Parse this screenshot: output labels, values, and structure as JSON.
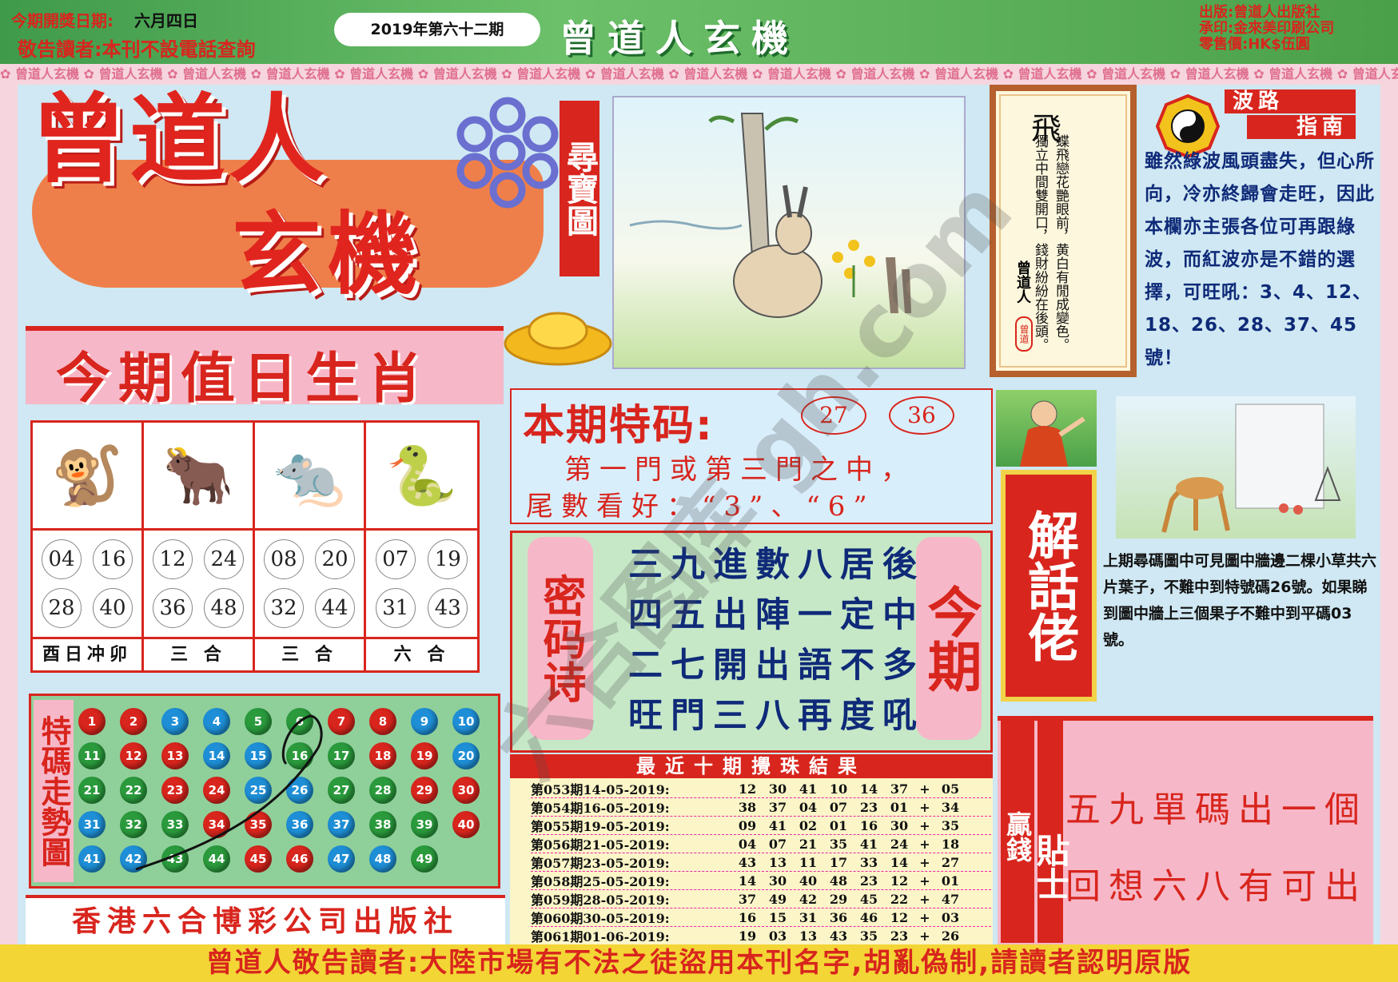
{
  "header": {
    "date_label": "今期開獎日期:",
    "date_value": "六月四日",
    "notice": "敬告讀者:本刊不設電話查詢",
    "issue": "2019年第六十二期",
    "title": "曾道人玄機",
    "publisher_lines": [
      "出版:曾道人出版社",
      "承印:金來美印刷公司",
      "零售價:HK$伍圓"
    ]
  },
  "border_text": "曾道人玄機",
  "logo": {
    "line1": "曾道人",
    "line2": "玄機"
  },
  "treasure": {
    "label": "尋寶圖"
  },
  "poem": {
    "title": "飛",
    "text": "蝶飛戀花艷眼前，黄白有閒成變色。獨立中間雙開口，錢財紛紛在後頭。",
    "signature": "曾道人",
    "seal": "曾道"
  },
  "bolu": {
    "title1": "波路",
    "title2": "指南",
    "text": "雖然綠波風頭盡失，但心所向，冷亦終歸會走旺，因此本欄亦主張各位可再跟綠波，而紅波亦是不錯的選擇，可旺吼：3、4、12、18、26、28、37、45號！"
  },
  "zodiac": {
    "title": "今期值日生肖",
    "columns": [
      {
        "icon": "monkey-icon",
        "glyph": "🐒",
        "numbers": [
          "04",
          "16",
          "28",
          "40"
        ],
        "label": "酉日冲卯"
      },
      {
        "icon": "ox-icon",
        "glyph": "🐂",
        "numbers": [
          "12",
          "24",
          "36",
          "48"
        ],
        "label": "三 合"
      },
      {
        "icon": "rat-icon",
        "glyph": "🐀",
        "numbers": [
          "08",
          "20",
          "32",
          "44"
        ],
        "label": "三 合"
      },
      {
        "icon": "snake-icon",
        "glyph": "🐍",
        "numbers": [
          "07",
          "19",
          "31",
          "43"
        ],
        "label": "六 合"
      }
    ]
  },
  "trend": {
    "label": "特碼走勢圖",
    "colors": {
      "red": "#d8251d",
      "blue": "#1e8fd6",
      "green": "#2a9a3c"
    },
    "balls": [
      {
        "n": "1",
        "c": "red"
      },
      {
        "n": "2",
        "c": "red"
      },
      {
        "n": "3",
        "c": "blue"
      },
      {
        "n": "4",
        "c": "blue"
      },
      {
        "n": "5",
        "c": "green"
      },
      {
        "n": "6",
        "c": "green"
      },
      {
        "n": "7",
        "c": "red"
      },
      {
        "n": "8",
        "c": "red"
      },
      {
        "n": "9",
        "c": "blue"
      },
      {
        "n": "10",
        "c": "blue"
      },
      {
        "n": "11",
        "c": "green"
      },
      {
        "n": "12",
        "c": "red"
      },
      {
        "n": "13",
        "c": "red"
      },
      {
        "n": "14",
        "c": "blue"
      },
      {
        "n": "15",
        "c": "blue"
      },
      {
        "n": "16",
        "c": "green"
      },
      {
        "n": "17",
        "c": "green"
      },
      {
        "n": "18",
        "c": "red"
      },
      {
        "n": "19",
        "c": "red"
      },
      {
        "n": "20",
        "c": "blue"
      },
      {
        "n": "21",
        "c": "green"
      },
      {
        "n": "22",
        "c": "green"
      },
      {
        "n": "23",
        "c": "red"
      },
      {
        "n": "24",
        "c": "red"
      },
      {
        "n": "25",
        "c": "blue"
      },
      {
        "n": "26",
        "c": "blue"
      },
      {
        "n": "27",
        "c": "green"
      },
      {
        "n": "28",
        "c": "green"
      },
      {
        "n": "29",
        "c": "red"
      },
      {
        "n": "30",
        "c": "red"
      },
      {
        "n": "31",
        "c": "blue"
      },
      {
        "n": "32",
        "c": "green"
      },
      {
        "n": "33",
        "c": "green"
      },
      {
        "n": "34",
        "c": "red"
      },
      {
        "n": "35",
        "c": "red"
      },
      {
        "n": "36",
        "c": "blue"
      },
      {
        "n": "37",
        "c": "blue"
      },
      {
        "n": "38",
        "c": "green"
      },
      {
        "n": "39",
        "c": "green"
      },
      {
        "n": "40",
        "c": "red"
      },
      {
        "n": "41",
        "c": "blue"
      },
      {
        "n": "42",
        "c": "blue"
      },
      {
        "n": "43",
        "c": "green"
      },
      {
        "n": "44",
        "c": "green"
      },
      {
        "n": "45",
        "c": "red"
      },
      {
        "n": "46",
        "c": "red"
      },
      {
        "n": "47",
        "c": "blue"
      },
      {
        "n": "48",
        "c": "blue"
      },
      {
        "n": "49",
        "c": "green"
      }
    ]
  },
  "publisher": "香港六合博彩公司出版社",
  "special": {
    "title": "本期特码:",
    "numbers": [
      "27",
      "36"
    ],
    "line1": "第一門或第三門之中，",
    "line2": "尾數看好：“3”、“6”"
  },
  "secret_poem": {
    "label": "密码诗",
    "label2": "今期",
    "lines": [
      "三九進數八居後",
      "四五出陣一定中",
      "二七開出語不多",
      "旺門三八再度吼"
    ]
  },
  "results": {
    "title": "最近十期攪珠結果",
    "rows": [
      {
        "period": "第053期14-05-2019:",
        "nums": [
          "12",
          "30",
          "41",
          "10",
          "14",
          "37"
        ],
        "special": "05"
      },
      {
        "period": "第054期16-05-2019:",
        "nums": [
          "38",
          "37",
          "04",
          "07",
          "23",
          "01"
        ],
        "special": "34"
      },
      {
        "period": "第055期19-05-2019:",
        "nums": [
          "09",
          "41",
          "02",
          "01",
          "16",
          "30"
        ],
        "special": "35"
      },
      {
        "period": "第056期21-05-2019:",
        "nums": [
          "04",
          "07",
          "21",
          "35",
          "41",
          "24"
        ],
        "special": "18"
      },
      {
        "period": "第057期23-05-2019:",
        "nums": [
          "43",
          "13",
          "11",
          "17",
          "33",
          "14"
        ],
        "special": "27"
      },
      {
        "period": "第058期25-05-2019:",
        "nums": [
          "14",
          "30",
          "40",
          "48",
          "23",
          "12"
        ],
        "special": "01"
      },
      {
        "period": "第059期28-05-2019:",
        "nums": [
          "37",
          "49",
          "42",
          "29",
          "45",
          "22"
        ],
        "special": "47"
      },
      {
        "period": "第060期30-05-2019:",
        "nums": [
          "16",
          "15",
          "31",
          "36",
          "46",
          "12"
        ],
        "special": "03"
      },
      {
        "period": "第061期01-06-2019:",
        "nums": [
          "19",
          "03",
          "13",
          "43",
          "35",
          "23"
        ],
        "special": "26"
      }
    ],
    "plus": "+"
  },
  "jiehualao": {
    "label": "解話佬",
    "text": "上期尋碼圖中可見圖中牆邊二棵小草共六片葉子，不難中到特號碼26號。如果睇到圖中牆上三個果子不難中到平碼03號。"
  },
  "tieshi": {
    "label1": "贏錢",
    "label2": "貼士",
    "lines": [
      "五九單碼出一個",
      "回想六八有可出"
    ]
  },
  "footer": "曾道人敬告讀者:大陸市場有不法之徒盜用本刊名字,胡亂偽制,請讀者認明原版",
  "watermark": "六合图库 gh.com"
}
